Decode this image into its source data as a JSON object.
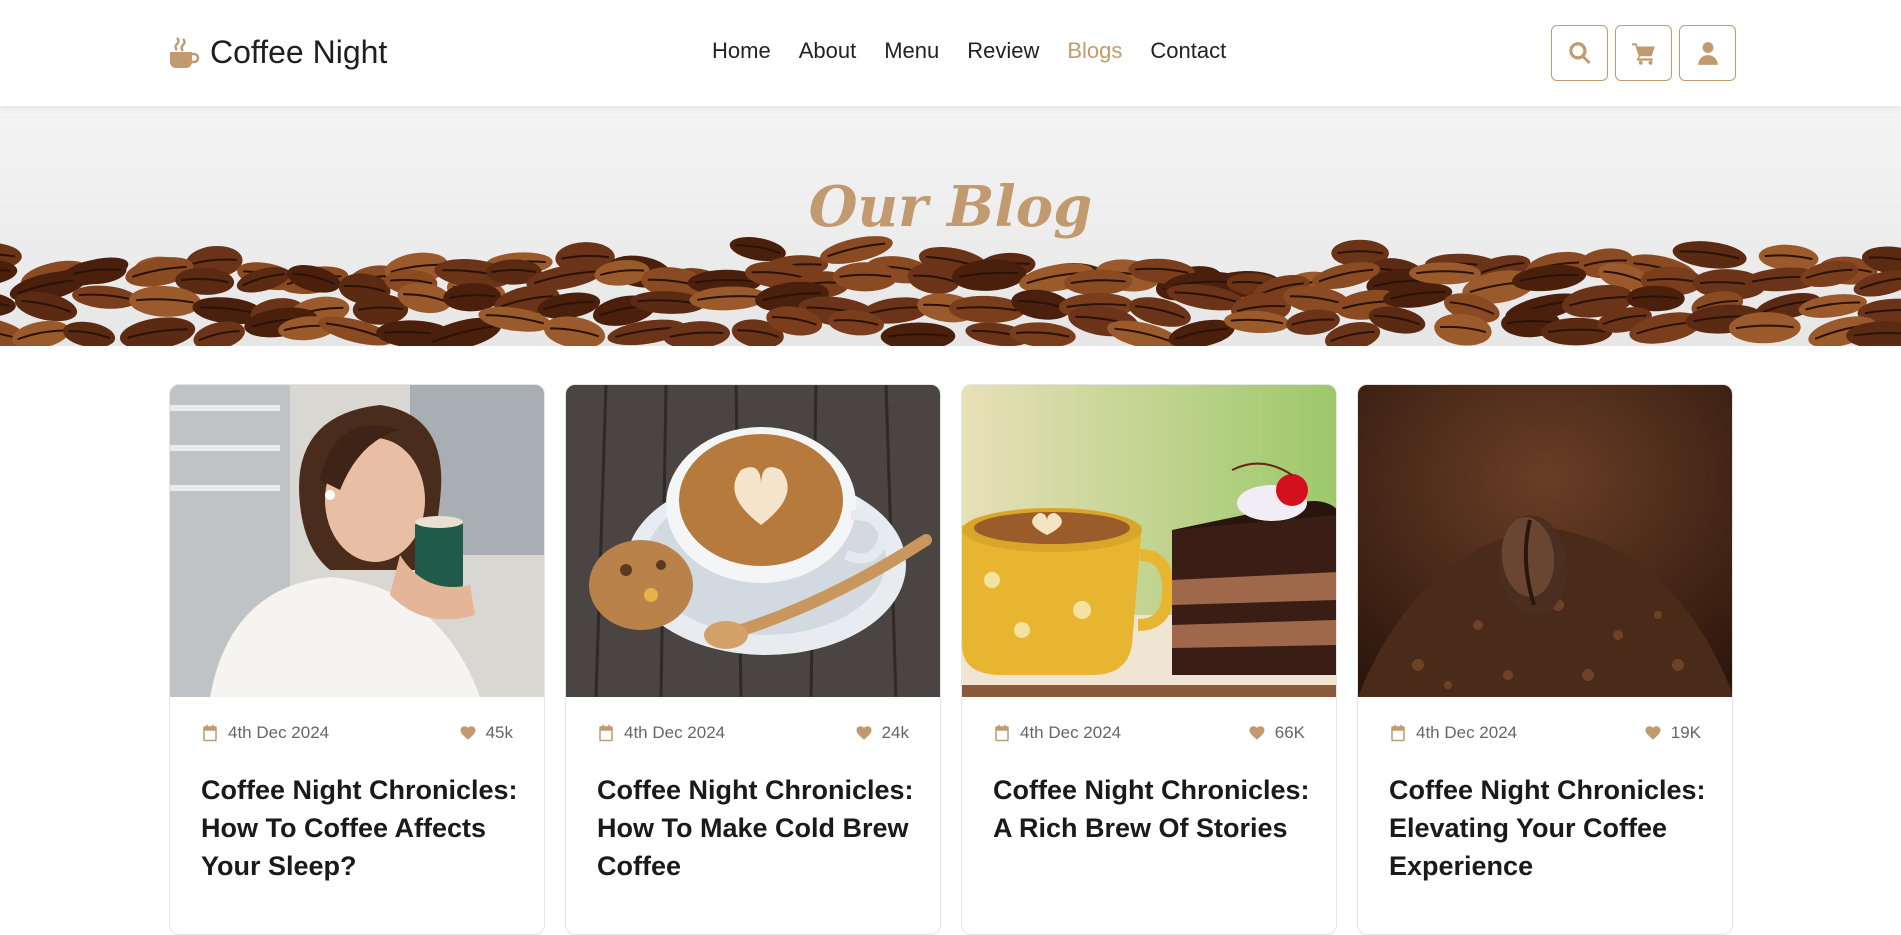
{
  "brand": {
    "name": "Coffee Night",
    "icon": "coffee-cup-icon",
    "accent": "#c29a6f"
  },
  "nav": [
    {
      "label": "Home",
      "active": false
    },
    {
      "label": "About",
      "active": false
    },
    {
      "label": "Menu",
      "active": false
    },
    {
      "label": "Review",
      "active": false
    },
    {
      "label": "Blogs",
      "active": true
    },
    {
      "label": "Contact",
      "active": false
    }
  ],
  "header_buttons": [
    "search-icon",
    "cart-icon",
    "user-icon"
  ],
  "banner": {
    "title": "Our Blog"
  },
  "posts": [
    {
      "date": "4th Dec 2024",
      "likes": "45k",
      "title": "Coffee Night Chronicles: How To Coffee Affects Your Sleep?"
    },
    {
      "date": "4th Dec 2024",
      "likes": "24k",
      "title": "Coffee Night Chronicles: How To Make Cold Brew Coffee"
    },
    {
      "date": "4th Dec 2024",
      "likes": "66K",
      "title": "Coffee Night Chronicles: A Rich Brew Of Stories"
    },
    {
      "date": "4th Dec 2024",
      "likes": "19K",
      "title": "Coffee Night Chronicles: Elevating Your Coffee Experience"
    }
  ]
}
